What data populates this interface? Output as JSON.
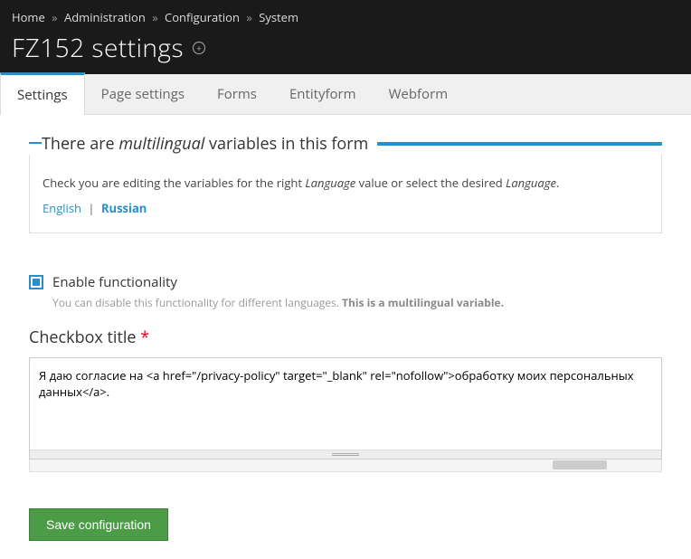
{
  "breadcrumb": {
    "items": [
      "Home",
      "Administration",
      "Configuration",
      "System"
    ],
    "sep": "»"
  },
  "page_title": "FZ152 settings",
  "tabs": [
    {
      "label": "Settings",
      "active": true
    },
    {
      "label": "Page settings",
      "active": false
    },
    {
      "label": "Forms",
      "active": false
    },
    {
      "label": "Entityform",
      "active": false
    },
    {
      "label": "Webform",
      "active": false
    }
  ],
  "multilingual_box": {
    "legend_prefix": "There are ",
    "legend_em": "multilingual",
    "legend_suffix": " variables in this form",
    "desc_prefix": "Check you are editing the variables for the right ",
    "desc_em1": "Language",
    "desc_mid": " value or select the desired ",
    "desc_em2": "Language",
    "desc_suffix": ".",
    "languages": [
      {
        "label": "English",
        "active": false
      },
      {
        "label": "Russian",
        "active": true
      }
    ],
    "lang_divider": "|"
  },
  "enable_checkbox": {
    "label": "Enable functionality",
    "checked": true,
    "help_prefix": "You can disable this functionality for different languages. ",
    "help_strong": "This is a multilingual variable."
  },
  "checkbox_title_field": {
    "label": "Checkbox title",
    "required_marker": "*",
    "value": "Я даю согласие на <a href=\"/privacy-policy\" target=\"_blank\" rel=\"nofollow\">обработку моих персональных данных</a>."
  },
  "save_button": "Save configuration"
}
